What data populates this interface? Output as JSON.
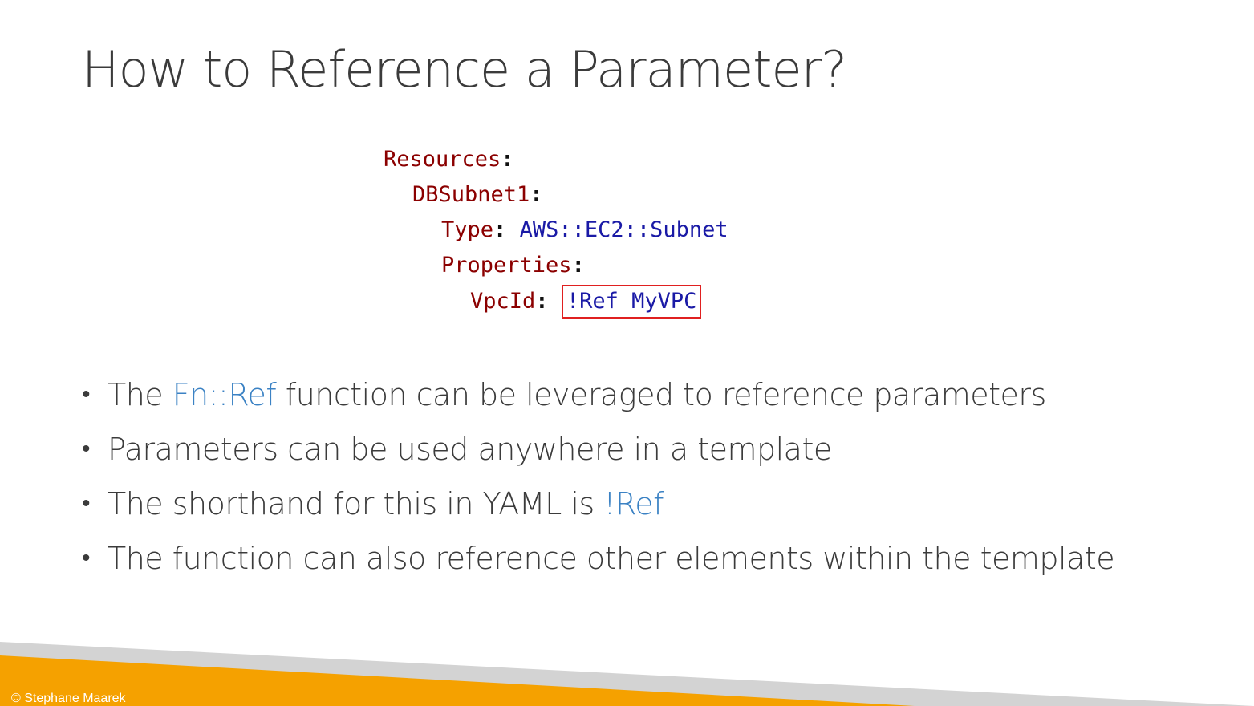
{
  "slide": {
    "title": "How to Reference a Parameter?"
  },
  "code": {
    "resources_key": "Resources",
    "resource_name": "DBSubnet1",
    "type_key": "Type",
    "type_value": "AWS::EC2::Subnet",
    "properties_key": "Properties",
    "vpcid_key": "VpcId",
    "vpcid_value": "!Ref MyVPC",
    "colon": ":"
  },
  "bullets": [
    {
      "before": "The ",
      "highlight": "Fn::Ref",
      "after": " function can be leveraged to reference parameters"
    },
    {
      "before": "Parameters can be used anywhere in a template",
      "highlight": "",
      "after": ""
    },
    {
      "before": "The shorthand for this in YAML is ",
      "highlight": "!Ref",
      "after": ""
    },
    {
      "before": "The function can also reference other elements within the template",
      "highlight": "",
      "after": ""
    }
  ],
  "bullet_glyph": "•",
  "footer": {
    "copyright": "© Stephane Maarek"
  },
  "colors": {
    "accent_orange": "#f5a100",
    "accent_gray": "#d3d3d3",
    "highlight_blue": "#3b82c4",
    "code_key_red": "#8b0000",
    "code_value_blue": "#1a1aa6",
    "box_red": "#e02020"
  }
}
